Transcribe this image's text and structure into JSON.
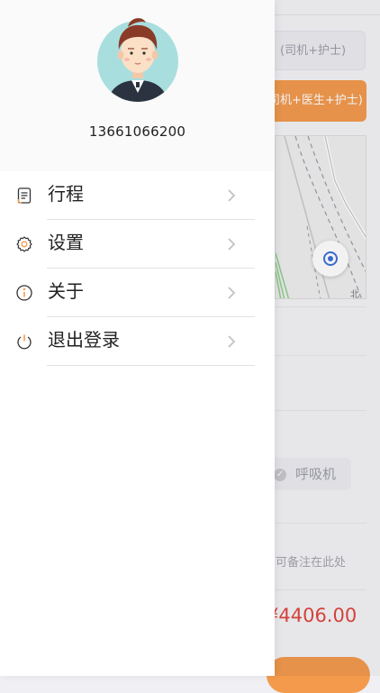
{
  "background": {
    "option_basic_label": "(司机+护士)",
    "option_full_label": "司机+医生+护士)",
    "map_partial_text": "北",
    "equipment_option_label": "呼吸机",
    "note_placeholder": "可备注在此处",
    "price_text": "¥4406.00"
  },
  "drawer": {
    "phone_number": "13661066200",
    "menu": [
      {
        "label": "行程",
        "icon": "document-icon"
      },
      {
        "label": "设置",
        "icon": "gear-icon"
      },
      {
        "label": "关于",
        "icon": "info-icon"
      },
      {
        "label": "退出登录",
        "icon": "power-icon"
      }
    ]
  },
  "colors": {
    "accent_orange": "#f39a4c",
    "price_red": "#e0453c"
  }
}
